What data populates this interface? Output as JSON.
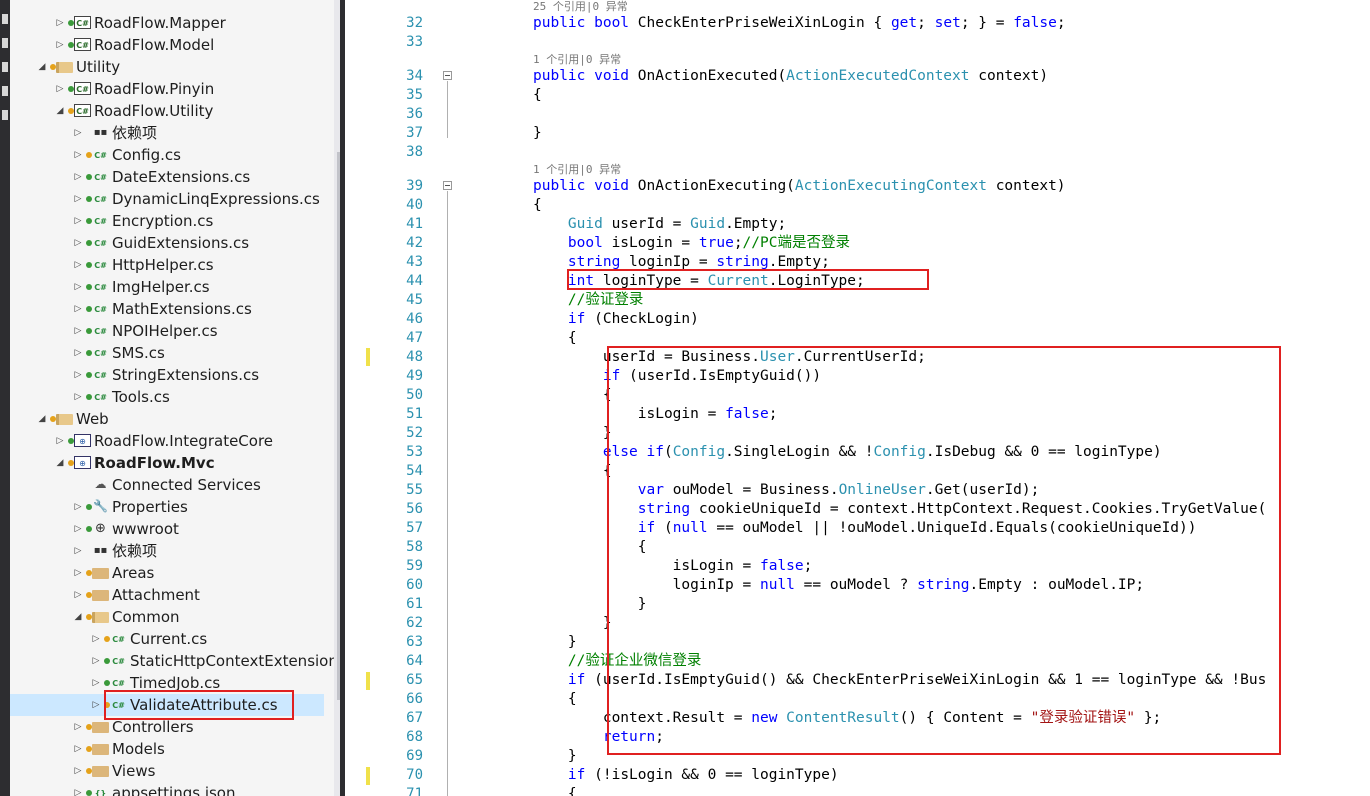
{
  "solution_explorer": {
    "items": [
      {
        "label": "RoadFlow.Mapper",
        "icon": "csharp-project-icon",
        "status": "green",
        "expander": "collapsed",
        "bold": false
      },
      {
        "label": "RoadFlow.Model",
        "icon": "csharp-project-icon",
        "status": "green",
        "expander": "collapsed",
        "bold": false
      },
      {
        "label": "Utility",
        "icon": "folder-open-icon",
        "status": "orange",
        "expander": "expanded",
        "bold": false
      },
      {
        "label": "RoadFlow.Pinyin",
        "icon": "csharp-project-icon",
        "status": "green",
        "expander": "collapsed",
        "bold": false
      },
      {
        "label": "RoadFlow.Utility",
        "icon": "csharp-project-icon",
        "status": "orange",
        "expander": "expanded",
        "bold": false
      },
      {
        "label": "依赖项",
        "icon": "dependencies-icon",
        "status": "",
        "expander": "collapsed",
        "bold": false
      },
      {
        "label": "Config.cs",
        "icon": "csharp-file-icon",
        "status": "orange",
        "expander": "collapsed",
        "bold": false
      },
      {
        "label": "DateExtensions.cs",
        "icon": "csharp-file-icon",
        "status": "green",
        "expander": "collapsed",
        "bold": false
      },
      {
        "label": "DynamicLinqExpressions.cs",
        "icon": "csharp-file-icon",
        "status": "green",
        "expander": "collapsed",
        "bold": false
      },
      {
        "label": "Encryption.cs",
        "icon": "csharp-file-icon",
        "status": "green",
        "expander": "collapsed",
        "bold": false
      },
      {
        "label": "GuidExtensions.cs",
        "icon": "csharp-file-icon",
        "status": "green",
        "expander": "collapsed",
        "bold": false
      },
      {
        "label": "HttpHelper.cs",
        "icon": "csharp-file-icon",
        "status": "green",
        "expander": "collapsed",
        "bold": false
      },
      {
        "label": "ImgHelper.cs",
        "icon": "csharp-file-icon",
        "status": "green",
        "expander": "collapsed",
        "bold": false
      },
      {
        "label": "MathExtensions.cs",
        "icon": "csharp-file-icon",
        "status": "green",
        "expander": "collapsed",
        "bold": false
      },
      {
        "label": "NPOIHelper.cs",
        "icon": "csharp-file-icon",
        "status": "green",
        "expander": "collapsed",
        "bold": false
      },
      {
        "label": "SMS.cs",
        "icon": "csharp-file-icon",
        "status": "green",
        "expander": "collapsed",
        "bold": false
      },
      {
        "label": "StringExtensions.cs",
        "icon": "csharp-file-icon",
        "status": "green",
        "expander": "collapsed",
        "bold": false
      },
      {
        "label": "Tools.cs",
        "icon": "csharp-file-icon",
        "status": "green",
        "expander": "collapsed",
        "bold": false
      },
      {
        "label": "Web",
        "icon": "folder-open-icon",
        "status": "orange",
        "expander": "expanded",
        "bold": false
      },
      {
        "label": "RoadFlow.IntegrateCore",
        "icon": "web-project-icon",
        "status": "green",
        "expander": "collapsed",
        "bold": false
      },
      {
        "label": "RoadFlow.Mvc",
        "icon": "web-project-icon",
        "status": "orange",
        "expander": "expanded",
        "bold": true
      },
      {
        "label": "Connected Services",
        "icon": "connected-services-icon",
        "status": "",
        "expander": "none",
        "bold": false
      },
      {
        "label": "Properties",
        "icon": "wrench-icon",
        "status": "green",
        "expander": "collapsed",
        "bold": false
      },
      {
        "label": "wwwroot",
        "icon": "globe-icon",
        "status": "green",
        "expander": "collapsed",
        "bold": false
      },
      {
        "label": "依赖项",
        "icon": "dependencies-icon",
        "status": "",
        "expander": "collapsed",
        "bold": false
      },
      {
        "label": "Areas",
        "icon": "folder-icon",
        "status": "orange",
        "expander": "collapsed",
        "bold": false
      },
      {
        "label": "Attachment",
        "icon": "folder-icon",
        "status": "orange",
        "expander": "collapsed",
        "bold": false
      },
      {
        "label": "Common",
        "icon": "folder-open-icon",
        "status": "orange",
        "expander": "expanded",
        "bold": false
      },
      {
        "label": "Current.cs",
        "icon": "csharp-file-icon",
        "status": "orange",
        "expander": "collapsed",
        "bold": false
      },
      {
        "label": "StaticHttpContextExtension",
        "icon": "csharp-file-icon",
        "status": "green",
        "expander": "collapsed",
        "bold": false
      },
      {
        "label": "TimedJob.cs",
        "icon": "csharp-file-icon",
        "status": "green",
        "expander": "collapsed",
        "bold": false
      },
      {
        "label": "ValidateAttribute.cs",
        "icon": "csharp-file-icon",
        "status": "orange",
        "expander": "collapsed",
        "bold": false
      },
      {
        "label": "Controllers",
        "icon": "folder-icon",
        "status": "orange",
        "expander": "collapsed",
        "bold": false
      },
      {
        "label": "Models",
        "icon": "folder-icon",
        "status": "orange",
        "expander": "collapsed",
        "bold": false
      },
      {
        "label": "Views",
        "icon": "folder-icon",
        "status": "orange",
        "expander": "collapsed",
        "bold": false
      },
      {
        "label": "appsettings.json",
        "icon": "json-file-icon",
        "status": "green",
        "expander": "collapsed",
        "bold": false
      }
    ],
    "selected_label": "ValidateAttribute.cs"
  },
  "editor": {
    "code_lens": {
      "l32": "25 个引用|0 异常",
      "l34": "1 个引用|0 异常",
      "l39": "1 个引用|0 异常"
    },
    "lines": [
      {
        "num": "32",
        "tokens": [
          [
            "kw",
            "public "
          ],
          [
            "kw",
            "bool "
          ],
          [
            "p",
            "CheckEnterPriseWeiXinLogin { "
          ],
          [
            "kw",
            "get"
          ],
          [
            "p",
            "; "
          ],
          [
            "kw",
            "set"
          ],
          [
            "p",
            "; } = "
          ],
          [
            "kw",
            "false"
          ],
          [
            "p",
            ";"
          ]
        ]
      },
      {
        "num": "33",
        "tokens": []
      },
      {
        "num": "34",
        "tokens": [
          [
            "kw",
            "public "
          ],
          [
            "kw",
            "void "
          ],
          [
            "p",
            "OnActionExecuted("
          ],
          [
            "ty",
            "ActionExecutedContext"
          ],
          [
            "p",
            " context)"
          ]
        ]
      },
      {
        "num": "35",
        "tokens": [
          [
            "p",
            "{"
          ]
        ]
      },
      {
        "num": "36",
        "tokens": []
      },
      {
        "num": "37",
        "tokens": [
          [
            "p",
            "}"
          ]
        ]
      },
      {
        "num": "38",
        "tokens": []
      },
      {
        "num": "39",
        "tokens": [
          [
            "kw",
            "public "
          ],
          [
            "kw",
            "void "
          ],
          [
            "p",
            "OnActionExecuting("
          ],
          [
            "ty",
            "ActionExecutingContext"
          ],
          [
            "p",
            " context)"
          ]
        ]
      },
      {
        "num": "40",
        "tokens": [
          [
            "p",
            "{"
          ]
        ]
      },
      {
        "num": "41",
        "tokens": [
          [
            "p",
            "    "
          ],
          [
            "ty",
            "Guid"
          ],
          [
            "p",
            " userId = "
          ],
          [
            "ty",
            "Guid"
          ],
          [
            "p",
            ".Empty;"
          ]
        ]
      },
      {
        "num": "42",
        "tokens": [
          [
            "p",
            "    "
          ],
          [
            "kw",
            "bool "
          ],
          [
            "p",
            "isLogin = "
          ],
          [
            "kw",
            "true"
          ],
          [
            "p",
            ";"
          ],
          [
            "cm",
            "//PC端是否登录"
          ]
        ]
      },
      {
        "num": "43",
        "tokens": [
          [
            "p",
            "    "
          ],
          [
            "kw",
            "string "
          ],
          [
            "p",
            "loginIp = "
          ],
          [
            "kw",
            "string"
          ],
          [
            "p",
            ".Empty;"
          ]
        ]
      },
      {
        "num": "44",
        "tokens": [
          [
            "p",
            "    "
          ],
          [
            "kw",
            "int "
          ],
          [
            "p",
            "loginType = "
          ],
          [
            "ty",
            "Current"
          ],
          [
            "p",
            ".LoginType;"
          ]
        ]
      },
      {
        "num": "45",
        "tokens": [
          [
            "p",
            "    "
          ],
          [
            "cm",
            "//验证登录"
          ]
        ]
      },
      {
        "num": "46",
        "tokens": [
          [
            "p",
            "    "
          ],
          [
            "kw",
            "if "
          ],
          [
            "p",
            "(CheckLogin)"
          ]
        ]
      },
      {
        "num": "47",
        "tokens": [
          [
            "p",
            "    {"
          ]
        ]
      },
      {
        "num": "48",
        "tokens": [
          [
            "p",
            "        userId = Business."
          ],
          [
            "ty",
            "User"
          ],
          [
            "p",
            ".CurrentUserId;"
          ]
        ]
      },
      {
        "num": "49",
        "tokens": [
          [
            "p",
            "        "
          ],
          [
            "kw",
            "if "
          ],
          [
            "p",
            "(userId.IsEmptyGuid())"
          ]
        ]
      },
      {
        "num": "50",
        "tokens": [
          [
            "p",
            "        {"
          ]
        ]
      },
      {
        "num": "51",
        "tokens": [
          [
            "p",
            "            isLogin = "
          ],
          [
            "kw",
            "false"
          ],
          [
            "p",
            ";"
          ]
        ]
      },
      {
        "num": "52",
        "tokens": [
          [
            "p",
            "        }"
          ]
        ]
      },
      {
        "num": "53",
        "tokens": [
          [
            "p",
            "        "
          ],
          [
            "kw",
            "else if"
          ],
          [
            "p",
            "("
          ],
          [
            "ty",
            "Config"
          ],
          [
            "p",
            ".SingleLogin && !"
          ],
          [
            "ty",
            "Config"
          ],
          [
            "p",
            ".IsDebug && 0 == loginType)"
          ]
        ]
      },
      {
        "num": "54",
        "tokens": [
          [
            "p",
            "        {"
          ]
        ]
      },
      {
        "num": "55",
        "tokens": [
          [
            "p",
            "            "
          ],
          [
            "kw",
            "var "
          ],
          [
            "p",
            "ouModel = Business."
          ],
          [
            "ty",
            "OnlineUser"
          ],
          [
            "p",
            ".Get(userId);"
          ]
        ]
      },
      {
        "num": "56",
        "tokens": [
          [
            "p",
            "            "
          ],
          [
            "kw",
            "string "
          ],
          [
            "p",
            "cookieUniqueId = context.HttpContext.Request.Cookies.TryGetValue("
          ]
        ]
      },
      {
        "num": "57",
        "tokens": [
          [
            "p",
            "            "
          ],
          [
            "kw",
            "if "
          ],
          [
            "p",
            "("
          ],
          [
            "kw",
            "null"
          ],
          [
            "p",
            " == ouModel || !ouModel.UniqueId.Equals(cookieUniqueId))"
          ]
        ]
      },
      {
        "num": "58",
        "tokens": [
          [
            "p",
            "            {"
          ]
        ]
      },
      {
        "num": "59",
        "tokens": [
          [
            "p",
            "                isLogin = "
          ],
          [
            "kw",
            "false"
          ],
          [
            "p",
            ";"
          ]
        ]
      },
      {
        "num": "60",
        "tokens": [
          [
            "p",
            "                loginIp = "
          ],
          [
            "kw",
            "null"
          ],
          [
            "p",
            " == ouModel ? "
          ],
          [
            "kw",
            "string"
          ],
          [
            "p",
            ".Empty : ouModel.IP;"
          ]
        ]
      },
      {
        "num": "61",
        "tokens": [
          [
            "p",
            "            }"
          ]
        ]
      },
      {
        "num": "62",
        "tokens": [
          [
            "p",
            "        }"
          ]
        ]
      },
      {
        "num": "63",
        "tokens": [
          [
            "p",
            "    }"
          ]
        ]
      },
      {
        "num": "64",
        "tokens": [
          [
            "p",
            "    "
          ],
          [
            "cm",
            "//验证企业微信登录"
          ]
        ]
      },
      {
        "num": "65",
        "tokens": [
          [
            "p",
            "    "
          ],
          [
            "kw",
            "if "
          ],
          [
            "p",
            "(userId.IsEmptyGuid() && CheckEnterPriseWeiXinLogin && 1 == loginType && !Bus"
          ]
        ]
      },
      {
        "num": "66",
        "tokens": [
          [
            "p",
            "    {"
          ]
        ]
      },
      {
        "num": "67",
        "tokens": [
          [
            "p",
            "        context.Result = "
          ],
          [
            "kw",
            "new "
          ],
          [
            "ty",
            "ContentResult"
          ],
          [
            "p",
            "() { Content = "
          ],
          [
            "st",
            "\"登录验证错误\""
          ],
          [
            "p",
            " };"
          ]
        ]
      },
      {
        "num": "68",
        "tokens": [
          [
            "p",
            "        "
          ],
          [
            "kw",
            "return"
          ],
          [
            "p",
            ";"
          ]
        ]
      },
      {
        "num": "69",
        "tokens": [
          [
            "p",
            "    }"
          ]
        ]
      },
      {
        "num": "70",
        "tokens": [
          [
            "p",
            "    "
          ],
          [
            "kw",
            "if "
          ],
          [
            "p",
            "(!isLogin && 0 == loginType)"
          ]
        ]
      },
      {
        "num": "71",
        "tokens": [
          [
            "p",
            "    {"
          ]
        ]
      }
    ]
  }
}
